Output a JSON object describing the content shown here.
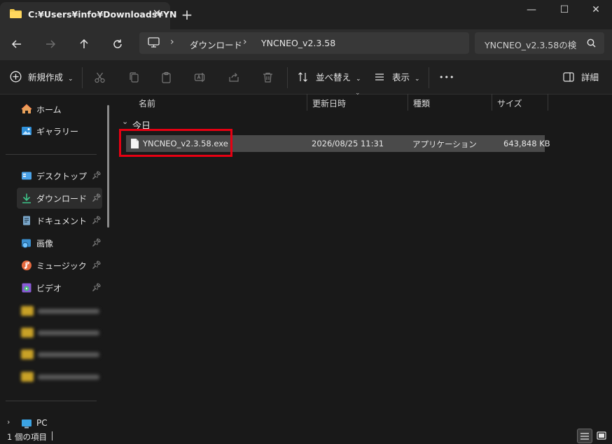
{
  "tab": {
    "title": "C:¥Users¥info¥Downloads¥YN",
    "close_glyph": "✕",
    "new_glyph": "+"
  },
  "window_controls": {
    "minimize": "—",
    "maximize": "☐",
    "close": "✕"
  },
  "address": {
    "crumbs": [
      "ダウンロード",
      "YNCNEO_v2.3.58"
    ]
  },
  "search": {
    "value": "YNCNEO_v2.3.58の検"
  },
  "toolbar": {
    "new_label": "新規作成",
    "sort_label": "並べ替え",
    "view_label": "表示",
    "more_label": "•••",
    "details_label": "詳細"
  },
  "sidebar": {
    "home": "ホーム",
    "gallery": "ギャラリー",
    "pinned": [
      {
        "label": "デスクトップ",
        "icon": "desktop-icon"
      },
      {
        "label": "ダウンロード",
        "icon": "download-icon"
      },
      {
        "label": "ドキュメント",
        "icon": "document-icon"
      },
      {
        "label": "画像",
        "icon": "pictures-icon"
      },
      {
        "label": "ミュージック",
        "icon": "music-icon"
      },
      {
        "label": "ビデオ",
        "icon": "video-icon"
      }
    ],
    "pc": "PC"
  },
  "columns": {
    "name": "名前",
    "modified": "更新日時",
    "type": "種類",
    "size": "サイズ"
  },
  "group": {
    "label": "今日"
  },
  "files": [
    {
      "name": "YNCNEO_v2.3.58.exe",
      "modified": "2026/08/25 11:31",
      "type": "アプリケーション",
      "size": "643,848 KB"
    }
  ],
  "status": {
    "count": "1 個の項目"
  },
  "colors": {
    "highlight": "#e60012",
    "selected_row": "#4a4a4a",
    "accent_pin": "#cfcfcf"
  }
}
